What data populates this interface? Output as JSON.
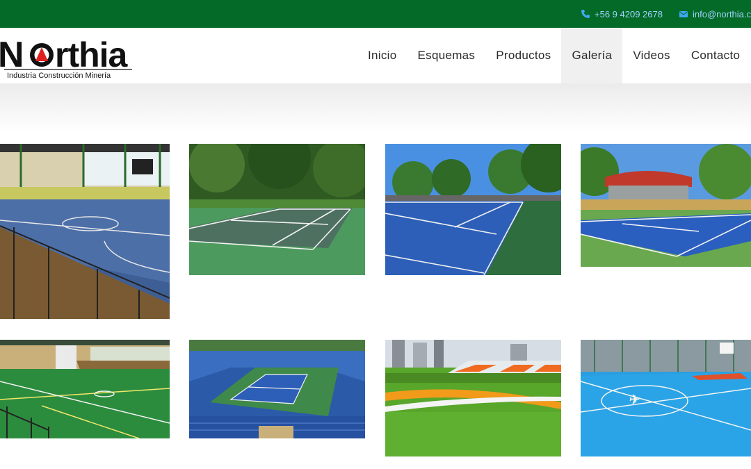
{
  "topbar": {
    "phone": "+56 9 4209 2678",
    "email": "info@northia.c",
    "phone_icon": "phone-icon",
    "email_icon": "envelope-icon",
    "background": "#046a27",
    "text_color": "#9fd3ff"
  },
  "logo": {
    "name": "Northia",
    "tagline": "Industria Construcción Minería"
  },
  "nav": {
    "items": [
      {
        "label": "Inicio"
      },
      {
        "label": "Esquemas"
      },
      {
        "label": "Productos"
      },
      {
        "label": "Galería",
        "active": true
      },
      {
        "label": "Videos"
      },
      {
        "label": "Contacto"
      }
    ]
  },
  "gallery": {
    "images": [
      {
        "subject": "indoor multi-sport court"
      },
      {
        "subject": "green tennis court"
      },
      {
        "subject": "blue tennis court"
      },
      {
        "subject": "blue tennis court with red roof"
      },
      {
        "subject": "green indoor court"
      },
      {
        "subject": "tennis stadium"
      },
      {
        "subject": "artificial turf field"
      },
      {
        "subject": "light blue outdoor court"
      }
    ]
  }
}
